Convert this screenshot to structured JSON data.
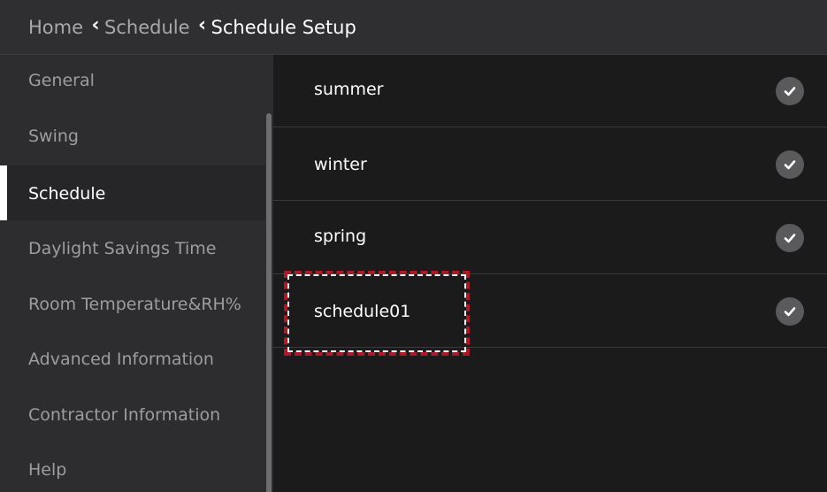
{
  "breadcrumb": {
    "home": "Home",
    "schedule": "Schedule",
    "current": "Schedule Setup",
    "separator_icon": "chevron-left-icon"
  },
  "sidebar": {
    "items": [
      {
        "label": "General",
        "active": false
      },
      {
        "label": "Swing",
        "active": false
      },
      {
        "label": "Schedule",
        "active": true
      },
      {
        "label": "Daylight Savings Time",
        "active": false
      },
      {
        "label": "Room Temperature&RH%",
        "active": false
      },
      {
        "label": "Advanced Information",
        "active": false
      },
      {
        "label": "Contractor Information",
        "active": false
      },
      {
        "label": "Help",
        "active": false
      }
    ]
  },
  "schedules": [
    {
      "name": "summer",
      "enabled": true
    },
    {
      "name": "winter",
      "enabled": true
    },
    {
      "name": "spring",
      "enabled": true
    },
    {
      "name": "schedule01",
      "enabled": true,
      "highlighted": true
    }
  ],
  "colors": {
    "header_bg": "#2f2f31",
    "sidebar_bg": "#2d2d2f",
    "content_bg": "#1b1b1b",
    "highlight_red": "#b01825",
    "check_bg": "#5a5a5c"
  }
}
